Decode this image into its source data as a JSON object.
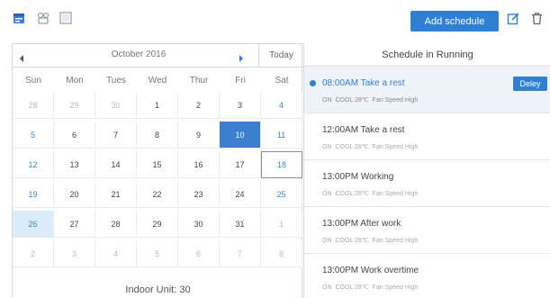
{
  "toolbar": {
    "icons": [
      "calendar-icon",
      "unit-icon",
      "grid-icon",
      "edit-icon",
      "trash-icon"
    ],
    "add_label": "Add schedule"
  },
  "calendar": {
    "month_label": "October 2016",
    "today_label": "Today",
    "weekdays": [
      "Sun",
      "Mon",
      "Tues",
      "Wed",
      "Thur",
      "Fri",
      "Sat"
    ],
    "weeks": [
      [
        {
          "d": "28",
          "m": true
        },
        {
          "d": "29",
          "m": true
        },
        {
          "d": "30",
          "m": true
        },
        {
          "d": "1"
        },
        {
          "d": "2"
        },
        {
          "d": "3"
        },
        {
          "d": "4"
        }
      ],
      [
        {
          "d": "5"
        },
        {
          "d": "6"
        },
        {
          "d": "7"
        },
        {
          "d": "8"
        },
        {
          "d": "9"
        },
        {
          "d": "10",
          "sel": true
        },
        {
          "d": "11"
        }
      ],
      [
        {
          "d": "12"
        },
        {
          "d": "13"
        },
        {
          "d": "14"
        },
        {
          "d": "15"
        },
        {
          "d": "16"
        },
        {
          "d": "17"
        },
        {
          "d": "18",
          "today": true
        }
      ],
      [
        {
          "d": "19"
        },
        {
          "d": "20"
        },
        {
          "d": "21"
        },
        {
          "d": "22"
        },
        {
          "d": "23"
        },
        {
          "d": "24"
        },
        {
          "d": "25"
        }
      ],
      [
        {
          "d": "26",
          "hl": true
        },
        {
          "d": "27"
        },
        {
          "d": "28"
        },
        {
          "d": "29"
        },
        {
          "d": "30"
        },
        {
          "d": "31"
        },
        {
          "d": "1",
          "m": true
        }
      ],
      [
        {
          "d": "2",
          "m": true
        },
        {
          "d": "3",
          "m": true
        },
        {
          "d": "4",
          "m": true
        },
        {
          "d": "5",
          "m": true
        },
        {
          "d": "6",
          "m": true
        },
        {
          "d": "7",
          "m": true
        },
        {
          "d": "8",
          "m": true
        }
      ]
    ],
    "footer": "Indoor Unit: 30"
  },
  "panel": {
    "title": "Schedule in Running",
    "delay_label": "Deley",
    "items": [
      {
        "time": "08:00AM Take a rest",
        "status": "ON",
        "mode": "COOL 28℃",
        "fan": "Fan Speed High",
        "active": true
      },
      {
        "time": "12:00AM Take a rest",
        "status": "ON",
        "mode": "COOL 28℃",
        "fan": "Fan Speed High"
      },
      {
        "time": "13:00PM Working",
        "status": "ON",
        "mode": "COOL 28℃",
        "fan": "Fan Speed High"
      },
      {
        "time": "13:00PM After work",
        "status": "ON",
        "mode": "COOL 28℃",
        "fan": "Fan Speed High"
      },
      {
        "time": "13:00PM Work overtime",
        "status": "ON",
        "mode": "COOL 28℃",
        "fan": "Fan Speed High"
      }
    ]
  },
  "colors": {
    "accent": "#2f7fd3",
    "selected_day": "#3b7fce",
    "highlight_day": "#dcebfa"
  }
}
